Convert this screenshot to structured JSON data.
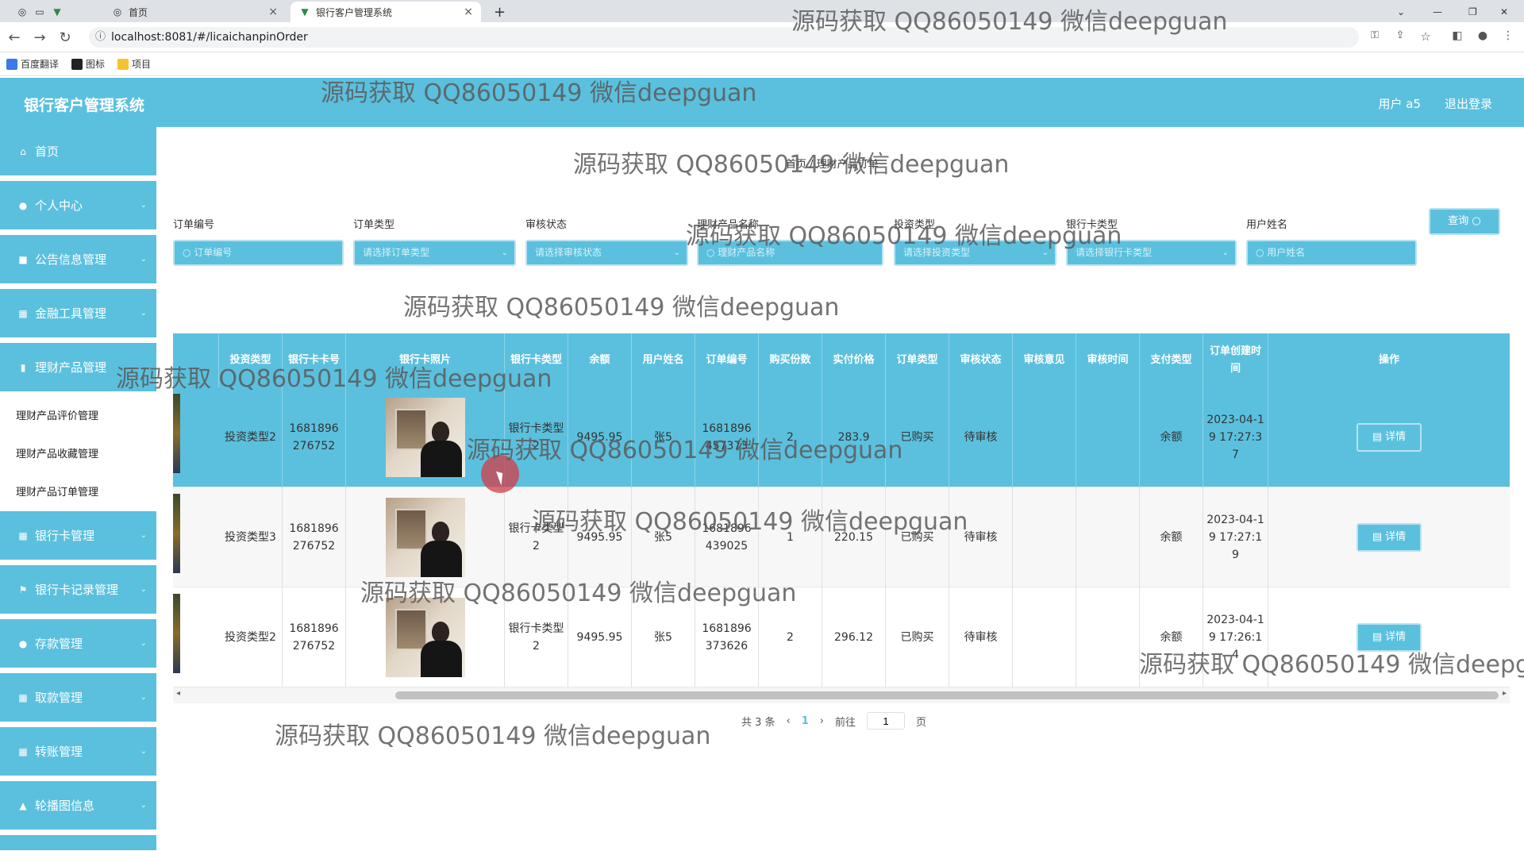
{
  "browser": {
    "tabs": [
      {
        "title": "首页"
      },
      {
        "title": "银行客户管理系统"
      }
    ],
    "url": "localhost:8081/#/licaichanpinOrder",
    "bookmarks": [
      "百度翻译",
      "图标",
      "项目"
    ]
  },
  "app": {
    "title": "银行客户管理系统",
    "user_label": "用户 a5",
    "logout_label": "退出登录"
  },
  "sidebar": {
    "items": [
      {
        "label": "首页",
        "icon": "home-icon"
      },
      {
        "label": "个人中心",
        "icon": "user-icon"
      },
      {
        "label": "公告信息管理",
        "icon": "notice-icon"
      },
      {
        "label": "金融工具管理",
        "icon": "grid-icon"
      },
      {
        "label": "理财产品管理",
        "icon": "chart-icon"
      },
      {
        "label": "银行卡管理",
        "icon": "grid-icon"
      },
      {
        "label": "银行卡记录管理",
        "icon": "flag-icon"
      },
      {
        "label": "存款管理",
        "icon": "user-icon"
      },
      {
        "label": "取款管理",
        "icon": "grid-icon"
      },
      {
        "label": "转账管理",
        "icon": "grid-icon"
      },
      {
        "label": "轮播图信息",
        "icon": "image-icon"
      }
    ],
    "subitems": [
      "理财产品评价管理",
      "理财产品收藏管理",
      "理财产品订单管理"
    ]
  },
  "breadcrumb": "首页 / 理财产品订单",
  "filters": [
    {
      "label": "订单编号",
      "placeholder": "订单编号"
    },
    {
      "label": "订单类型",
      "placeholder": "请选择订单类型"
    },
    {
      "label": "审核状态",
      "placeholder": "请选择审核状态"
    },
    {
      "label": "理财产品名称",
      "placeholder": "理财产品名称"
    },
    {
      "label": "投资类型",
      "placeholder": "请选择投资类型"
    },
    {
      "label": "银行卡类型",
      "placeholder": "请选择银行卡类型"
    },
    {
      "label": "用户姓名",
      "placeholder": "用户姓名"
    }
  ],
  "query_label": "查询",
  "table": {
    "columns": [
      "投资类型",
      "银行卡卡号",
      "银行卡照片",
      "银行卡类型",
      "余额",
      "用户姓名",
      "订单编号",
      "购买份数",
      "实付价格",
      "订单类型",
      "审核状态",
      "审核意见",
      "审核时间",
      "支付类型",
      "订单创建时间",
      "操作"
    ],
    "rows": [
      {
        "invest_type": "投资类型2",
        "card_no": "1681896276752",
        "card_type": "银行卡类型2",
        "balance": "9495.95",
        "user": "张5",
        "order_no": "1681896457373",
        "qty": "2",
        "price": "283.9",
        "order_type": "已购买",
        "status": "待审核",
        "opinion": "",
        "audit_time": "",
        "pay_type": "余额",
        "created": "2023-04-19 17:27:37",
        "action": "详情"
      },
      {
        "invest_type": "投资类型3",
        "card_no": "1681896276752",
        "card_type": "银行卡类型2",
        "balance": "9495.95",
        "user": "张5",
        "order_no": "1681896439025",
        "qty": "1",
        "price": "220.15",
        "order_type": "已购买",
        "status": "待审核",
        "opinion": "",
        "audit_time": "",
        "pay_type": "余额",
        "created": "2023-04-19 17:27:19",
        "action": "详情"
      },
      {
        "invest_type": "投资类型2",
        "card_no": "1681896276752",
        "card_type": "银行卡类型2",
        "balance": "9495.95",
        "user": "张5",
        "order_no": "1681896373626",
        "qty": "2",
        "price": "296.12",
        "order_type": "已购买",
        "status": "待审核",
        "opinion": "",
        "audit_time": "",
        "pay_type": "余额",
        "created": "2023-04-19 17:26:14",
        "action": "详情"
      }
    ]
  },
  "pager": {
    "total": "共 3 条",
    "current": "1",
    "goto_label": "前往",
    "page_value": "1",
    "page_suffix": "页"
  },
  "watermark": "源码获取 QQ86050149 微信deepguan",
  "accent_color": "#5bc0de"
}
